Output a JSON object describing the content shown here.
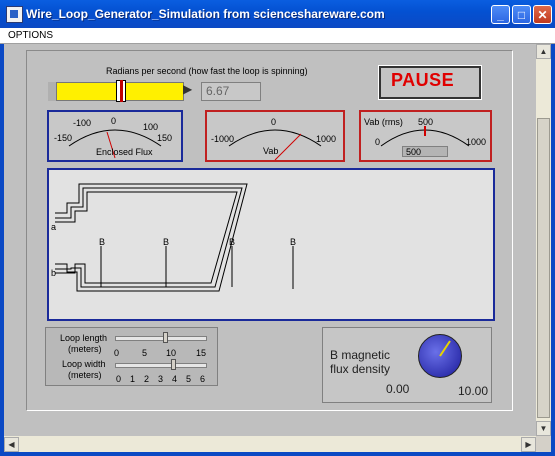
{
  "window": {
    "title": "Wire_Loop_Generator_Simulation from scienceshareware.com"
  },
  "menu": {
    "options": "OPTIONS"
  },
  "speed": {
    "label": "Radians per second (how fast the loop is spinning)",
    "value": "6.67"
  },
  "pause_button": {
    "label": "PAUSE"
  },
  "flux_meter": {
    "ticks": [
      "-100",
      "0",
      "100",
      "-150",
      "150"
    ],
    "label": "Enclosed Flux"
  },
  "vab_meter": {
    "ticks": [
      "0",
      "-1000",
      "1000"
    ],
    "label": "Vab"
  },
  "rms_meter": {
    "label": "Vab (rms)",
    "ticks": [
      "500",
      "0",
      "1000"
    ],
    "readout": "500"
  },
  "loop": {
    "terminal_a": "a",
    "terminal_b": "b",
    "b_labels": [
      "B",
      "B",
      "B",
      "B"
    ]
  },
  "loop_length": {
    "label_line1": "Loop length",
    "label_line2": "(meters)",
    "ticks": [
      "0",
      "5",
      "10",
      "15"
    ]
  },
  "loop_width": {
    "label_line1": "Loop width",
    "label_line2": "(meters)",
    "ticks": [
      "0",
      "1",
      "2",
      "3",
      "4",
      "5",
      "6"
    ]
  },
  "b_field": {
    "label_line1": "B magnetic",
    "label_line2": "flux density",
    "min": "0.00",
    "max": "10.00"
  },
  "icons": [
    "app-icon",
    "minimize-icon",
    "maximize-icon",
    "close-icon"
  ]
}
